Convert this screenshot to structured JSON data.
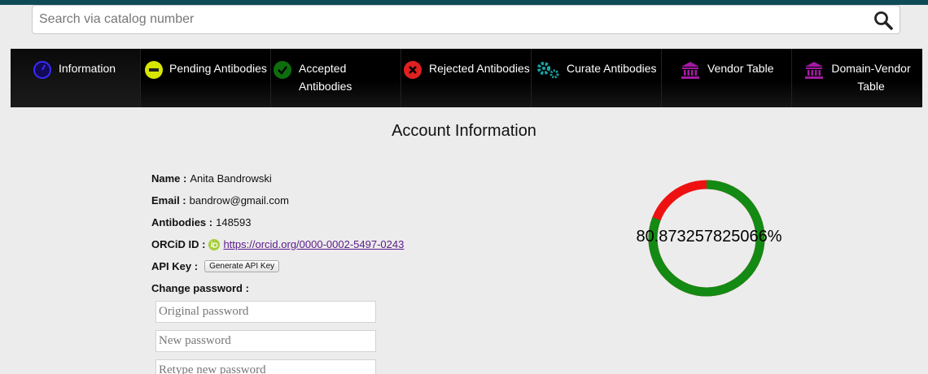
{
  "search": {
    "placeholder": "Search via catalog number"
  },
  "nav": [
    {
      "label": "Information",
      "icon": "info-icon",
      "color": "#2b2bff"
    },
    {
      "label": "Pending Antibodies",
      "icon": "minus-circle-icon",
      "color": "#d6e600"
    },
    {
      "label": "Accepted Antibodies",
      "icon": "check-circle-icon",
      "color": "#1a9a1a"
    },
    {
      "label": "Rejected Antibodies",
      "icon": "x-circle-icon",
      "color": "#e02020"
    },
    {
      "label": "Curate Antibodies",
      "icon": "gears-icon",
      "color": "#1aa7a7"
    },
    {
      "label": "Vendor Table",
      "icon": "bank-icon",
      "color": "#a21aa2"
    },
    {
      "label": "Domain-Vendor Table",
      "icon": "bank-icon",
      "color": "#a21aa2"
    }
  ],
  "page_title": "Account Information",
  "account": {
    "name_label": "Name :",
    "name": "Anita Bandrowski",
    "email_label": "Email :",
    "email": "bandrow@gmail.com",
    "antibodies_label": "Antibodies :",
    "antibodies": "148593",
    "orcid_label": "ORCiD ID :",
    "orcid_url": "https://orcid.org/0000-0002-5497-0243",
    "api_label": "API Key :",
    "api_button": "Generate API Key",
    "change_password_label": "Change password :"
  },
  "password_fields": {
    "original_placeholder": "Original password",
    "new_placeholder": "New password",
    "retype_placeholder": "Retype new password"
  },
  "progress": {
    "text": "80.87325782506​6%",
    "value": 0.8087325782506,
    "accepted_color": "#138a13",
    "remaining_color": "#ee1111"
  }
}
